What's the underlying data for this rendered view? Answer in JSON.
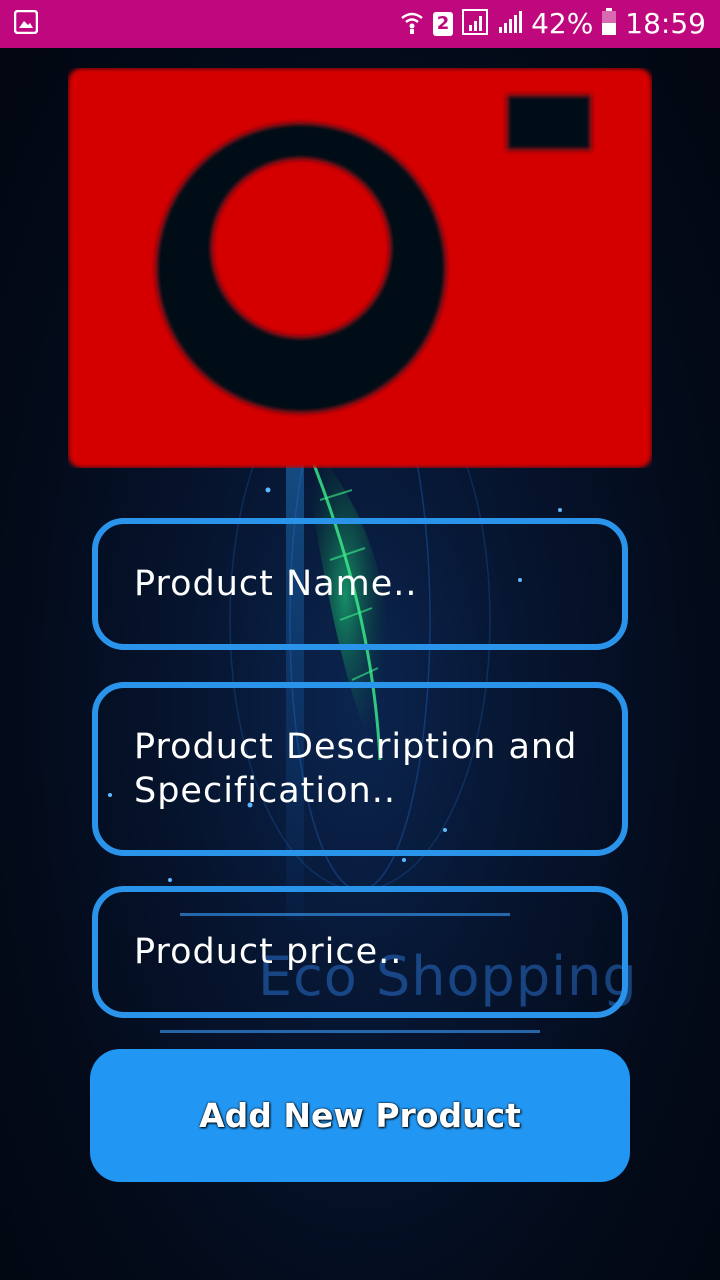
{
  "status_bar": {
    "sim_slot": "2",
    "battery": "42%",
    "time": "18:59",
    "color": "#c0087e"
  },
  "background": {
    "watermark": "Eco Shopping"
  },
  "image_picker": {
    "icon": "camera-icon",
    "color": "#d40000"
  },
  "form": {
    "name_placeholder": "Product Name..",
    "description_placeholder": "Product Description and Specification..",
    "price_placeholder": "Product price..",
    "field_border_color": "#2a93ea"
  },
  "actions": {
    "add_label": "Add New Product",
    "button_color": "#2196f3"
  }
}
